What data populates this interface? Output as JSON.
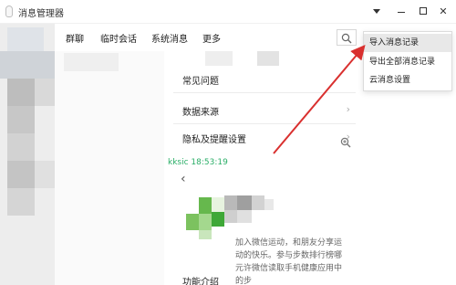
{
  "window": {
    "title": "消息管理器"
  },
  "tabs": [
    {
      "label": "群聊"
    },
    {
      "label": "临时会话"
    },
    {
      "label": "系统消息"
    },
    {
      "label": "更多"
    }
  ],
  "settings_rows": [
    {
      "label": "常见问题"
    },
    {
      "label": "数据来源"
    },
    {
      "label": "隐私及提醒设置"
    }
  ],
  "message": {
    "sender_time": "kksic 18:53:19",
    "feature_label": "功能介绍",
    "description": "加入微信运动，和朋友分享运动的快乐。参与步数排行榜哪元许微信读取手机健康应用中的步"
  },
  "dropdown_menu": {
    "items": [
      {
        "label": "导入消息记录"
      },
      {
        "label": "导出全部消息记录"
      },
      {
        "label": "云消息设置"
      }
    ],
    "highlighted_index": 0
  },
  "colors": {
    "accent_green": "#2aae67",
    "annotation_arrow": "#d9302f",
    "sidebar_bg": "#ededed"
  },
  "icons": {
    "window_menu": "caret-down-icon",
    "minimize": "minimize-icon",
    "maximize": "maximize-icon",
    "close": "close-icon",
    "search": "search-icon",
    "zoom": "zoom-in-icon",
    "back": "chevron-left-icon",
    "chevron_right": "chevron-right-icon"
  }
}
